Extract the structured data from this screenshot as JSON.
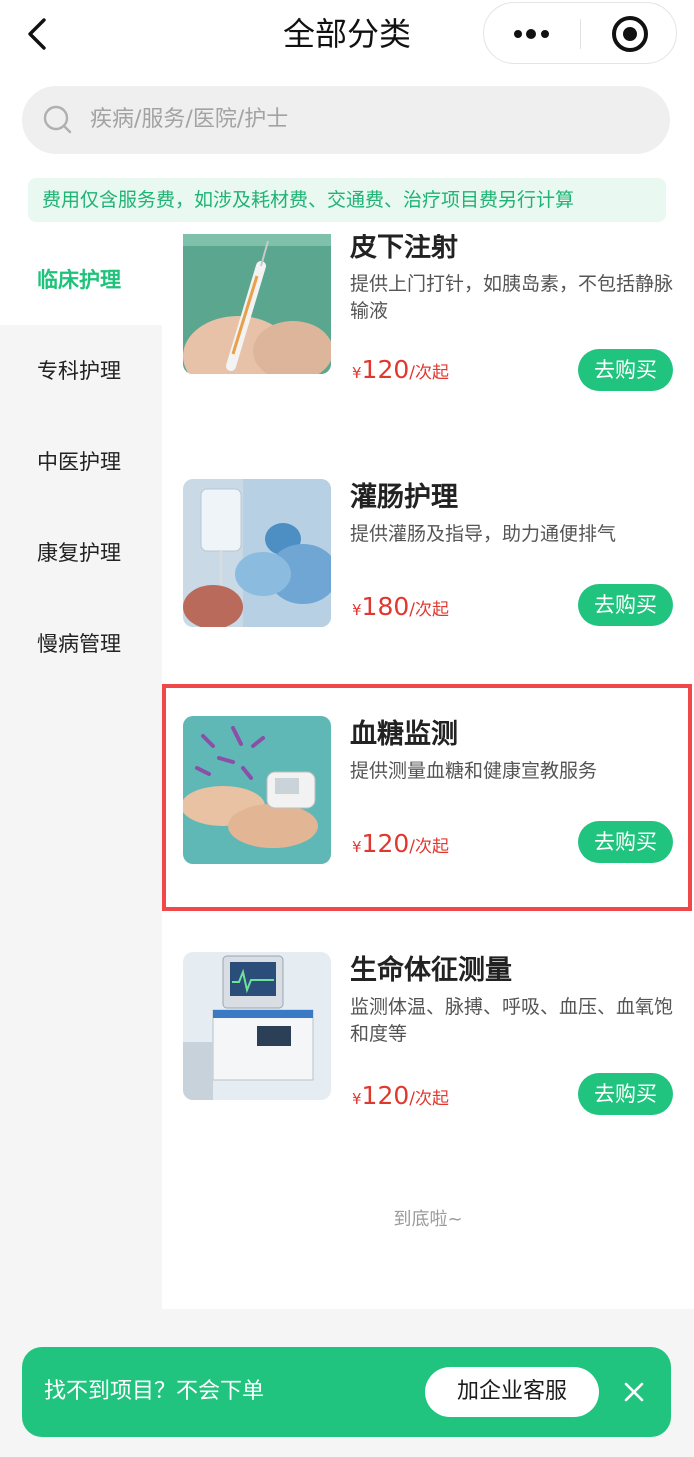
{
  "header": {
    "title": "全部分类"
  },
  "search": {
    "placeholder": "疾病/服务/医院/护士"
  },
  "notice": {
    "text": "费用仅含服务费，如涉及耗材费、交通费、治疗项目费另行计算"
  },
  "sidebar": {
    "items": [
      {
        "label": "临床护理",
        "active": true
      },
      {
        "label": "专科护理",
        "active": false
      },
      {
        "label": "中医护理",
        "active": false
      },
      {
        "label": "康复护理",
        "active": false
      },
      {
        "label": "慢病管理",
        "active": false
      }
    ]
  },
  "services": [
    {
      "title": "皮下注射",
      "desc": "提供上门打针，如胰岛素，不包括静脉输液",
      "currency": "¥",
      "price": "120",
      "unit": "/次起",
      "buy_label": "去购买",
      "image_icon": "syringe-photo"
    },
    {
      "title": "灌肠护理",
      "desc": "提供灌肠及指导，助力通便排气",
      "currency": "¥",
      "price": "180",
      "unit": "/次起",
      "buy_label": "去购买",
      "image_icon": "iv-drip-photo"
    },
    {
      "title": "血糖监测",
      "desc": "提供测量血糖和健康宣教服务",
      "currency": "¥",
      "price": "120",
      "unit": "/次起",
      "buy_label": "去购买",
      "image_icon": "glucose-meter-photo",
      "highlighted": true
    },
    {
      "title": "生命体征测量",
      "desc": "监测体温、脉搏、呼吸、血压、血氧饱和度等",
      "currency": "¥",
      "price": "120",
      "unit": "/次起",
      "buy_label": "去购买",
      "image_icon": "vital-monitor-photo"
    }
  ],
  "list_end": "到底啦~",
  "promo": {
    "text": "找不到项目？不会下单",
    "button": "加企业客服"
  },
  "colors": {
    "accent": "#20c47e",
    "price": "#e0382f",
    "highlight": "#f04848",
    "notice_bg": "#e9f8f0"
  }
}
